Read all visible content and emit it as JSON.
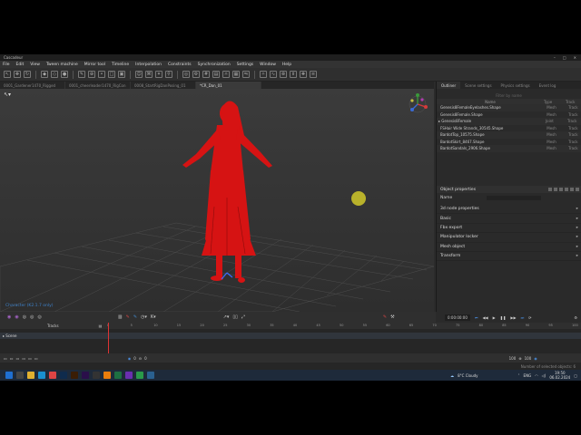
{
  "window": {
    "title": "Cascadeur",
    "controls": [
      "–",
      "□",
      "✕"
    ]
  },
  "menu": [
    "File",
    "Edit",
    "View",
    "Tween machine",
    "Mirror tool",
    "Timeline",
    "Interpolation",
    "Constraints",
    "Synchronization",
    "Settings",
    "Window",
    "Help"
  ],
  "doc_tabs": [
    {
      "label": "0001_Gardener1470_Rigged"
    },
    {
      "label": "0001_cheerleader1470_RigCon"
    },
    {
      "label": "0008_StartRigDanPosing_01"
    },
    {
      "label": "*CR_Dan_01",
      "active": true
    }
  ],
  "viewport": {
    "caption": "Character (K2.1.7 only)"
  },
  "right_panel": {
    "tabs": [
      {
        "label": "Outliner",
        "active": true
      },
      {
        "label": "Scene settings"
      },
      {
        "label": "Physics settings"
      },
      {
        "label": "Event log"
      }
    ],
    "filter_placeholder": "Filter by name",
    "columns": {
      "name": "Name",
      "type": "Type",
      "track": "Track"
    },
    "rows": [
      {
        "name": "Genesis8FemaleEyelashes.Shape",
        "type": "Mesh",
        "track": "Track"
      },
      {
        "name": "Genesis8Female.Shape",
        "type": "Mesh",
        "track": "Track"
      },
      {
        "name": "Genesis8Female",
        "type": "Joint",
        "track": "Track"
      },
      {
        "name": "FSHair Wide Strands_30545.Shape",
        "type": "Mesh",
        "track": "Track"
      },
      {
        "name": "BardotTop_10575.Shape",
        "type": "Mesh",
        "track": "Track"
      },
      {
        "name": "BardotSkirt_8467.Shape",
        "type": "Mesh",
        "track": "Track"
      },
      {
        "name": "BardotSandals_2906.Shape",
        "type": "Mesh",
        "track": "Track"
      }
    ],
    "object_properties_title": "Object properties",
    "name_label": "Name",
    "sections": [
      "3d node properties",
      "Basic",
      "Fbx export",
      "Manipulator locker",
      "Mesh object",
      "Transform"
    ]
  },
  "playback": {
    "time": "0:00:00:00"
  },
  "timeline": {
    "tracks_label": "Tracks",
    "scene_label": "Scene",
    "ruler": [
      "0",
      "5",
      "10",
      "15",
      "20",
      "25",
      "30",
      "35",
      "40",
      "45",
      "50",
      "55",
      "60",
      "65",
      "70",
      "75",
      "80",
      "85",
      "90",
      "95",
      "100"
    ],
    "start_frame": "0",
    "end_frame": "100",
    "end_frame_b": "100"
  },
  "status": {
    "text": "Number of selected objects: 6"
  },
  "taskbar": {
    "weather": "8°C Cloudy",
    "lang": "ENG",
    "time": "19:50",
    "date": "06.02.2024",
    "apps": [
      {
        "icon": "windows-icon",
        "color": "#1f6fd1"
      },
      {
        "icon": "search-icon",
        "color": "#444"
      },
      {
        "icon": "folder-icon",
        "color": "#e0b030"
      },
      {
        "icon": "edge-icon",
        "color": "#1a8fd0"
      },
      {
        "icon": "chrome-icon",
        "color": "#d44"
      },
      {
        "icon": "photoshop-icon",
        "color": "#0f2b4d"
      },
      {
        "icon": "illustrator-icon",
        "color": "#3a1d05"
      },
      {
        "icon": "premiere-icon",
        "color": "#2a0f4a"
      },
      {
        "icon": "daz-icon",
        "color": "#333"
      },
      {
        "icon": "blender-icon",
        "color": "#e87d0d"
      },
      {
        "icon": "excel-icon",
        "color": "#1d6f42"
      },
      {
        "icon": "visual-studio-icon",
        "color": "#6a2fb0"
      },
      {
        "icon": "spreadsheet-icon",
        "color": "#2a9a4a"
      },
      {
        "icon": "cascadeur-icon",
        "color": "#2a6090"
      }
    ]
  }
}
